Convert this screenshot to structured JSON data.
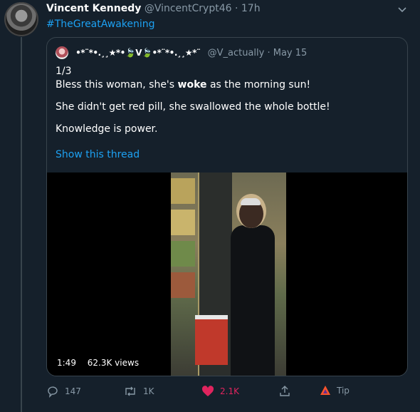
{
  "tweet": {
    "display_name": "Vincent Kennedy",
    "handle": "@VincentCrypt46",
    "separator": "·",
    "time": "17h",
    "hashtag": "#TheGreatAwakening"
  },
  "quote": {
    "display_name": "•*¨*•.¸¸★*•🍃V🍃•*¨*•.¸¸★*¨",
    "handle": "@V_actually",
    "separator": "·",
    "date": "May 15",
    "line1": "1/3",
    "line2_pre": "Bless this woman, she's ",
    "line2_bold": "woke",
    "line2_post": " as the morning sun!",
    "line3": "She didn't get red pill, she swallowed the whole bottle!",
    "line4": "Knowledge is power.",
    "show_thread": "Show this thread",
    "video_duration": "1:49",
    "video_views": "62.3K views"
  },
  "actions": {
    "reply_count": "147",
    "retweet_count": "1K",
    "like_count": "2.1K",
    "tip_label": "Tip"
  },
  "colors": {
    "background": "#15202b",
    "link": "#1da1f2",
    "muted": "#8899a6",
    "like": "#e0245e",
    "border": "#38444d"
  }
}
